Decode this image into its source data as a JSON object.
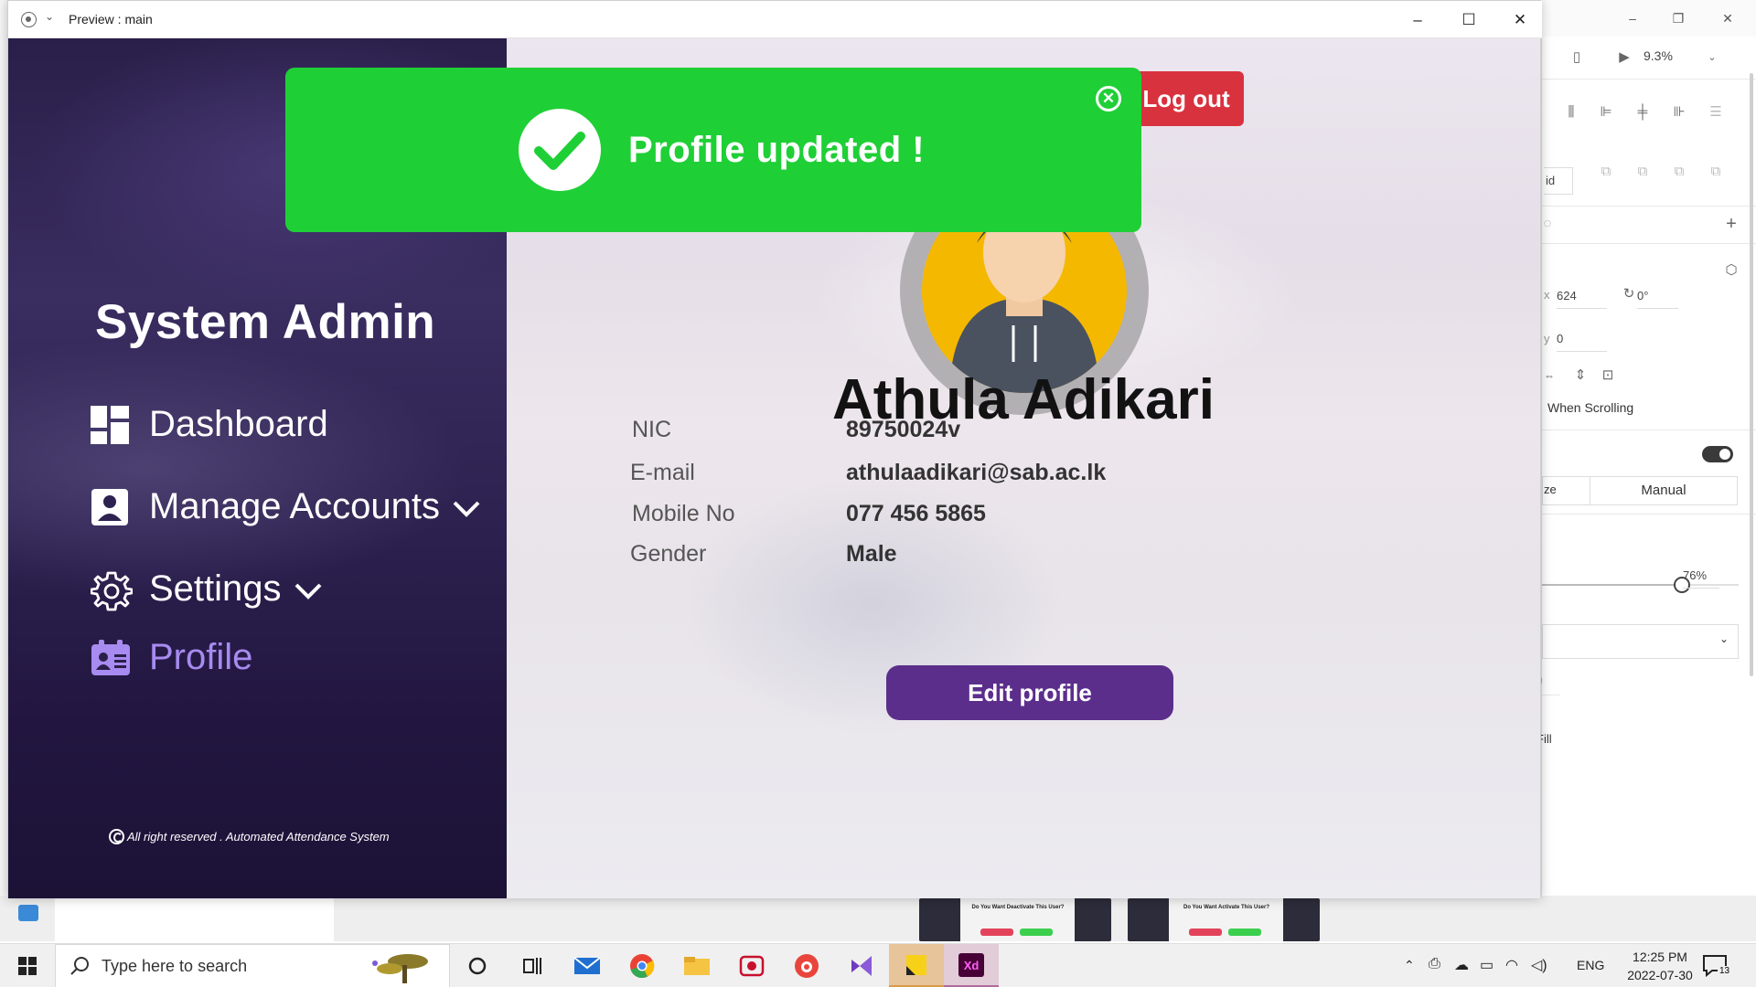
{
  "xd": {
    "zoom": "9.3%",
    "field_x": "624",
    "field_angle": "0°",
    "field_y": "0",
    "fixed_when_scrolling": "When Scrolling",
    "resize_label": "ze",
    "manual_label": "Manual",
    "opacity_value": "76%",
    "fill_label": "Fill",
    "grid_label": "id",
    "thumb1_title": "Do You Want Deactivate This User?",
    "thumb2_title": "Do You Want Activate This User?"
  },
  "preview": {
    "title": "Preview : main"
  },
  "sidebar": {
    "title": "System Admin",
    "items": [
      {
        "label": "Dashboard"
      },
      {
        "label": "Manage Accounts"
      },
      {
        "label": "Settings"
      },
      {
        "label": "Profile"
      }
    ],
    "footer": "All right reserved . Automated Attendance System"
  },
  "profile": {
    "name": "Athula Adikari",
    "fields": [
      {
        "label": "NIC",
        "value": "89750024v"
      },
      {
        "label": "E-mail",
        "value": "athulaadikari@sab.ac.lk"
      },
      {
        "label": "Mobile No",
        "value": "077 456 5865"
      },
      {
        "label": "Gender",
        "value": "Male"
      }
    ],
    "edit_label": "Edit profile",
    "logout_label": "Log out"
  },
  "toast": {
    "message": "Profile updated !"
  },
  "taskbar": {
    "search_placeholder": "Type here to search",
    "language": "ENG",
    "time": "12:25 PM",
    "date": "2022-07-30",
    "notification_count": "13"
  },
  "colors": {
    "sidebar_bg": "#2a1f4a",
    "accent_purple": "#5c2e8c",
    "profile_active": "#a78bf0",
    "logout_red": "#d9323f",
    "toast_green": "#1fcf36"
  }
}
